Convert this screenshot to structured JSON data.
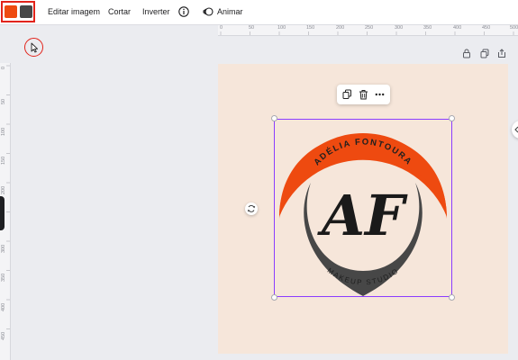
{
  "toolbar": {
    "colors": [
      "#ee4a10",
      "#474747"
    ],
    "edit_image_label": "Editar imagem",
    "crop_label": "Cortar",
    "flip_label": "Inverter",
    "animate_label": "Animar"
  },
  "ruler": {
    "top_ticks": [
      "0",
      "50",
      "100",
      "150",
      "200",
      "250",
      "300",
      "350",
      "400",
      "450",
      "500"
    ],
    "left_ticks": [
      "0",
      "50",
      "100",
      "150",
      "200",
      "250",
      "300",
      "350",
      "400",
      "450"
    ]
  },
  "logo": {
    "top_text": "ADÉLIA FONTOURA",
    "bottom_text": "MAKEUP STUDIO",
    "monogram": "AF",
    "primary_color": "#ee4a10",
    "secondary_color": "#474747",
    "background_color": "#f6e6da"
  },
  "icons": {
    "lock": "lock-icon",
    "duplicate_page": "duplicate-page-icon",
    "share": "share-icon",
    "copy": "copy-icon",
    "trash": "trash-icon",
    "more": "more-icon",
    "rotate": "rotate-icon",
    "info": "info-icon",
    "animate": "animate-icon",
    "cursor": "cursor-icon"
  }
}
